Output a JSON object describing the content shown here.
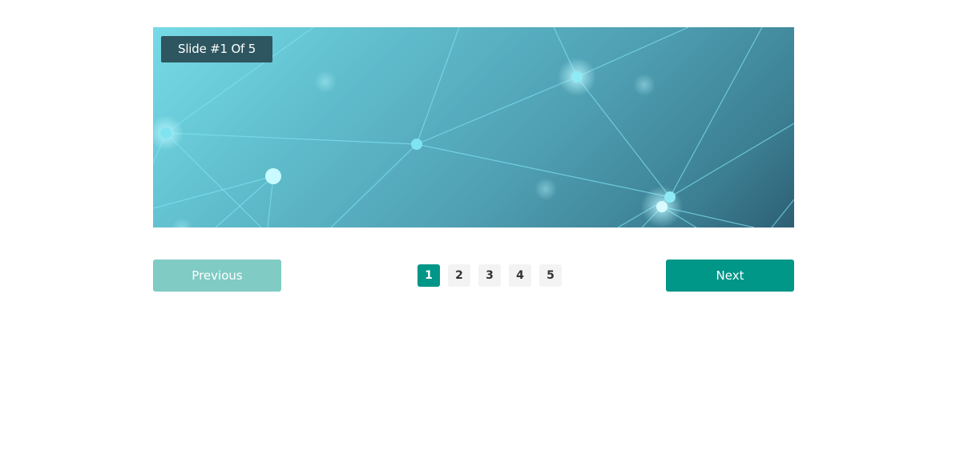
{
  "slider": {
    "badge": "Slide #1 Of 5"
  },
  "controls": {
    "previous_label": "Previous",
    "next_label": "Next",
    "pages": [
      {
        "label": "1",
        "active": true
      },
      {
        "label": "2",
        "active": false
      },
      {
        "label": "3",
        "active": false
      },
      {
        "label": "4",
        "active": false
      },
      {
        "label": "5",
        "active": false
      }
    ]
  },
  "colors": {
    "accent": "#009688",
    "accent_disabled": "#80cbc4",
    "badge_bg": "#2d5660",
    "page_bg": "#f3f3f3"
  }
}
